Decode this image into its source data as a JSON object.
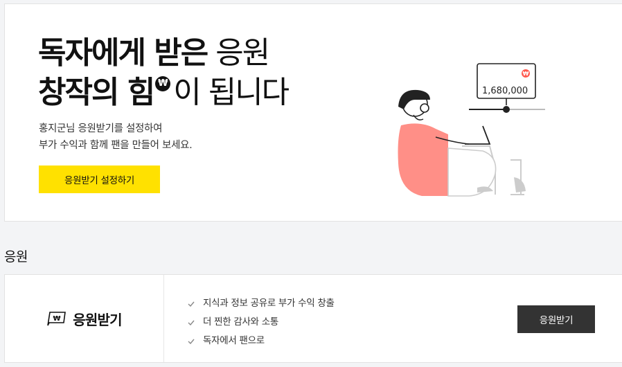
{
  "hero": {
    "title_line1_bold": "독자에게 받은",
    "title_line1_light": "응원",
    "title_line2_bold": "창작의 힘",
    "title_badge": "₩",
    "title_line2_light": "이 됩니다",
    "desc_line1": "홍지군님 응원받기를 설정하여",
    "desc_line2": "부가 수익과 함께 팬을 만들어 보세요.",
    "button_label": "응원받기 설정하기",
    "illustration_amount": "1,680,000",
    "illustration_badge": "₩"
  },
  "section": {
    "title": "응원"
  },
  "card": {
    "logo_badge": "₩",
    "logo_text": "응원받기",
    "features": [
      "지식과 정보 공유로 부가 수익 창출",
      "더 찐한 감사와 소통",
      "독자에서 팬으로"
    ],
    "button_label": "응원받기"
  },
  "colors": {
    "accent_yellow": "#ffe100",
    "dark_button": "#333333",
    "illustration_coral": "#ff8f87",
    "badge_red": "#ff5a4f"
  }
}
